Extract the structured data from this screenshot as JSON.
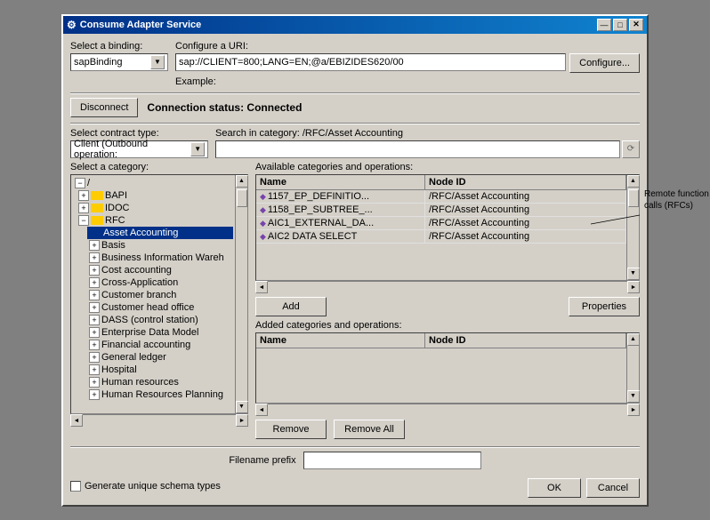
{
  "window": {
    "title": "Consume Adapter Service",
    "title_icon": "⚙"
  },
  "title_buttons": [
    "—",
    "□",
    "✕"
  ],
  "binding_label": "Select a binding:",
  "binding_value": "sapBinding",
  "uri_label": "Configure a URI:",
  "uri_value": "sap://CLIENT=800;LANG=EN;@a/EBIZIDES620/00",
  "configure_btn": "Configure...",
  "example_label": "Example:",
  "disconnect_btn": "Disconnect",
  "connection_status": "Connection status: Connected",
  "contract_type_label": "Select contract type:",
  "contract_type_value": "Client (Outbound operation:",
  "search_label": "Search in category: /RFC/Asset Accounting",
  "category_label": "Select a category:",
  "available_label": "Available categories and operations:",
  "table_headers": [
    "Name",
    "Node ID"
  ],
  "available_rows": [
    {
      "name": "1157_EP_DEFINITIO...",
      "node_id": "/RFC/Asset Accounting"
    },
    {
      "name": "1158_EP_SUBTREE_...",
      "node_id": "/RFC/Asset Accounting"
    },
    {
      "name": "AIC1_EXTERNAL_DA...",
      "node_id": "/RFC/Asset Accounting"
    },
    {
      "name": "AIC2 DATA SELECT",
      "node_id": "/RFC/Asset Accounting"
    }
  ],
  "add_btn": "Add",
  "properties_btn": "Properties",
  "added_label": "Added categories and operations:",
  "added_headers": [
    "Name",
    "Node ID"
  ],
  "added_rows": [],
  "remove_btn": "Remove",
  "remove_all_btn": "Remove All",
  "filename_label": "Filename prefix",
  "filename_value": "",
  "generate_checkbox_label": "Generate unique schema types",
  "ok_btn": "OK",
  "cancel_btn": "Cancel",
  "tree_items": [
    {
      "level": 1,
      "type": "root",
      "label": "/",
      "expanded": true
    },
    {
      "level": 2,
      "type": "folder",
      "label": "BAPI",
      "expanded": false
    },
    {
      "level": 2,
      "type": "folder",
      "label": "IDOC",
      "expanded": false
    },
    {
      "level": 2,
      "type": "folder",
      "label": "RFC",
      "expanded": true
    },
    {
      "level": 3,
      "type": "selected",
      "label": "Asset Accounting",
      "expanded": false
    },
    {
      "level": 3,
      "type": "folder",
      "label": "Basis",
      "expanded": false
    },
    {
      "level": 3,
      "type": "folder",
      "label": "Business Information Wareh",
      "expanded": false
    },
    {
      "level": 3,
      "type": "folder",
      "label": "Cost accounting",
      "expanded": false
    },
    {
      "level": 3,
      "type": "folder",
      "label": "Cross-Application",
      "expanded": false
    },
    {
      "level": 3,
      "type": "folder",
      "label": "Customer branch",
      "expanded": false
    },
    {
      "level": 3,
      "type": "folder",
      "label": "Customer head office",
      "expanded": false
    },
    {
      "level": 3,
      "type": "folder",
      "label": "DASS (control station)",
      "expanded": false
    },
    {
      "level": 3,
      "type": "folder",
      "label": "Enterprise Data Model",
      "expanded": false
    },
    {
      "level": 3,
      "type": "folder",
      "label": "Financial accounting",
      "expanded": false
    },
    {
      "level": 3,
      "type": "folder",
      "label": "General ledger",
      "expanded": false
    },
    {
      "level": 3,
      "type": "folder",
      "label": "Hospital",
      "expanded": false
    },
    {
      "level": 3,
      "type": "folder",
      "label": "Human resources",
      "expanded": false
    },
    {
      "level": 3,
      "type": "folder",
      "label": "Human Resources Planning",
      "expanded": false
    }
  ],
  "callout_text": "Remote function calls (RFCs)"
}
